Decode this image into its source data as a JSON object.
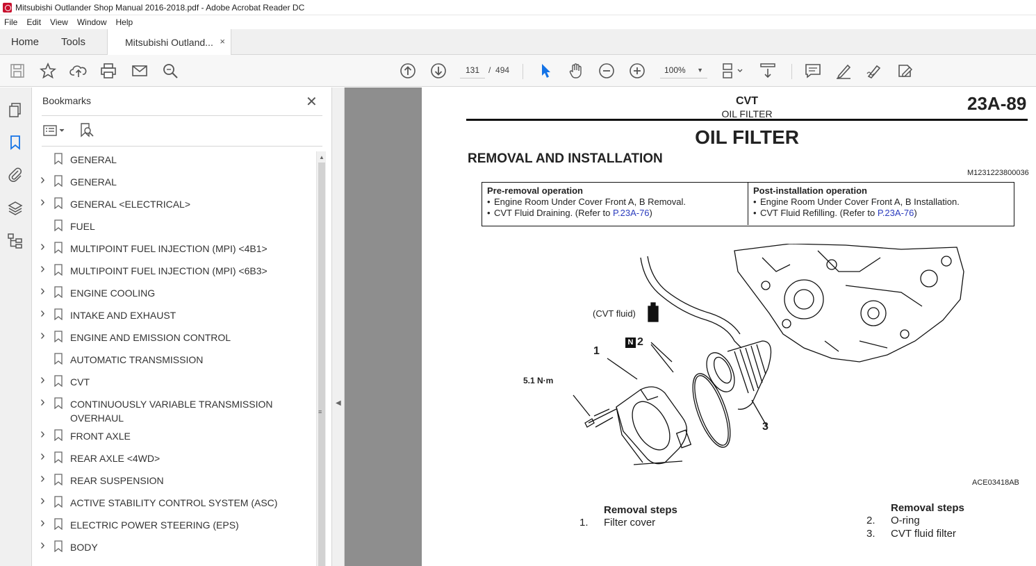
{
  "window": {
    "title": "Mitsubishi Outlander Shop Manual 2016-2018.pdf - Adobe Acrobat Reader DC"
  },
  "menu": [
    "File",
    "Edit",
    "View",
    "Window",
    "Help"
  ],
  "tabs": {
    "home": "Home",
    "tools": "Tools",
    "document": "Mitsubishi Outland...",
    "close": "×"
  },
  "toolbar": {
    "page_current": "131",
    "page_separator": "/",
    "page_total": "494",
    "zoom": "100%"
  },
  "bookmarks": {
    "title": "Bookmarks",
    "close": "✕",
    "items": [
      {
        "label": "GENERAL",
        "expandable": false
      },
      {
        "label": "GENERAL",
        "expandable": true
      },
      {
        "label": "GENERAL <ELECTRICAL>",
        "expandable": true
      },
      {
        "label": "FUEL",
        "expandable": false
      },
      {
        "label": "MULTIPOINT FUEL INJECTION (MPI) <4B1>",
        "expandable": true
      },
      {
        "label": "MULTIPOINT FUEL INJECTION (MPI) <6B3>",
        "expandable": true
      },
      {
        "label": "ENGINE COOLING",
        "expandable": true
      },
      {
        "label": "INTAKE AND EXHAUST",
        "expandable": true
      },
      {
        "label": "ENGINE AND EMISSION CONTROL",
        "expandable": true
      },
      {
        "label": "AUTOMATIC TRANSMISSION",
        "expandable": false
      },
      {
        "label": "CVT",
        "expandable": true
      },
      {
        "label": "CONTINUOUSLY VARIABLE TRANSMISSION OVERHAUL",
        "expandable": true
      },
      {
        "label": "FRONT AXLE",
        "expandable": true
      },
      {
        "label": "REAR AXLE <4WD>",
        "expandable": true
      },
      {
        "label": "REAR SUSPENSION",
        "expandable": true
      },
      {
        "label": "ACTIVE STABILITY CONTROL SYSTEM (ASC)",
        "expandable": true
      },
      {
        "label": "ELECTRIC POWER STEERING (EPS)",
        "expandable": true
      },
      {
        "label": "BODY",
        "expandable": true
      }
    ]
  },
  "page": {
    "section": "CVT",
    "subsection": "OIL FILTER",
    "number": "23A-89",
    "heading": "OIL FILTER",
    "subheading": "REMOVAL AND INSTALLATION",
    "code": "M1231223800036",
    "table": {
      "pre_title": "Pre-removal operation",
      "pre_1": "Engine Room Under Cover Front A, B Removal.",
      "pre_2": "CVT Fluid Draining. (Refer to ",
      "pre_2_link": "P.23A-76",
      "pre_2_end": ")",
      "post_title": "Post-installation operation",
      "post_1": "Engine Room Under Cover Front A, B Installation.",
      "post_2": "CVT Fluid Refilling. (Refer to ",
      "post_2_link": "P.23A-76",
      "post_2_end": ")"
    },
    "figure": {
      "fluid": "(CVT fluid)",
      "torque": "5.1 N·m",
      "n_badge": "N",
      "label_1": "1",
      "label_2": "2",
      "label_3": "3",
      "code": "ACE03418AB"
    },
    "steps_a": {
      "title": "Removal steps",
      "n1": "1.",
      "s1": "Filter cover"
    },
    "steps_b": {
      "title": "Removal steps",
      "n2": "2.",
      "s2": "O-ring",
      "n3": "3.",
      "s3": "CVT fluid filter"
    }
  }
}
